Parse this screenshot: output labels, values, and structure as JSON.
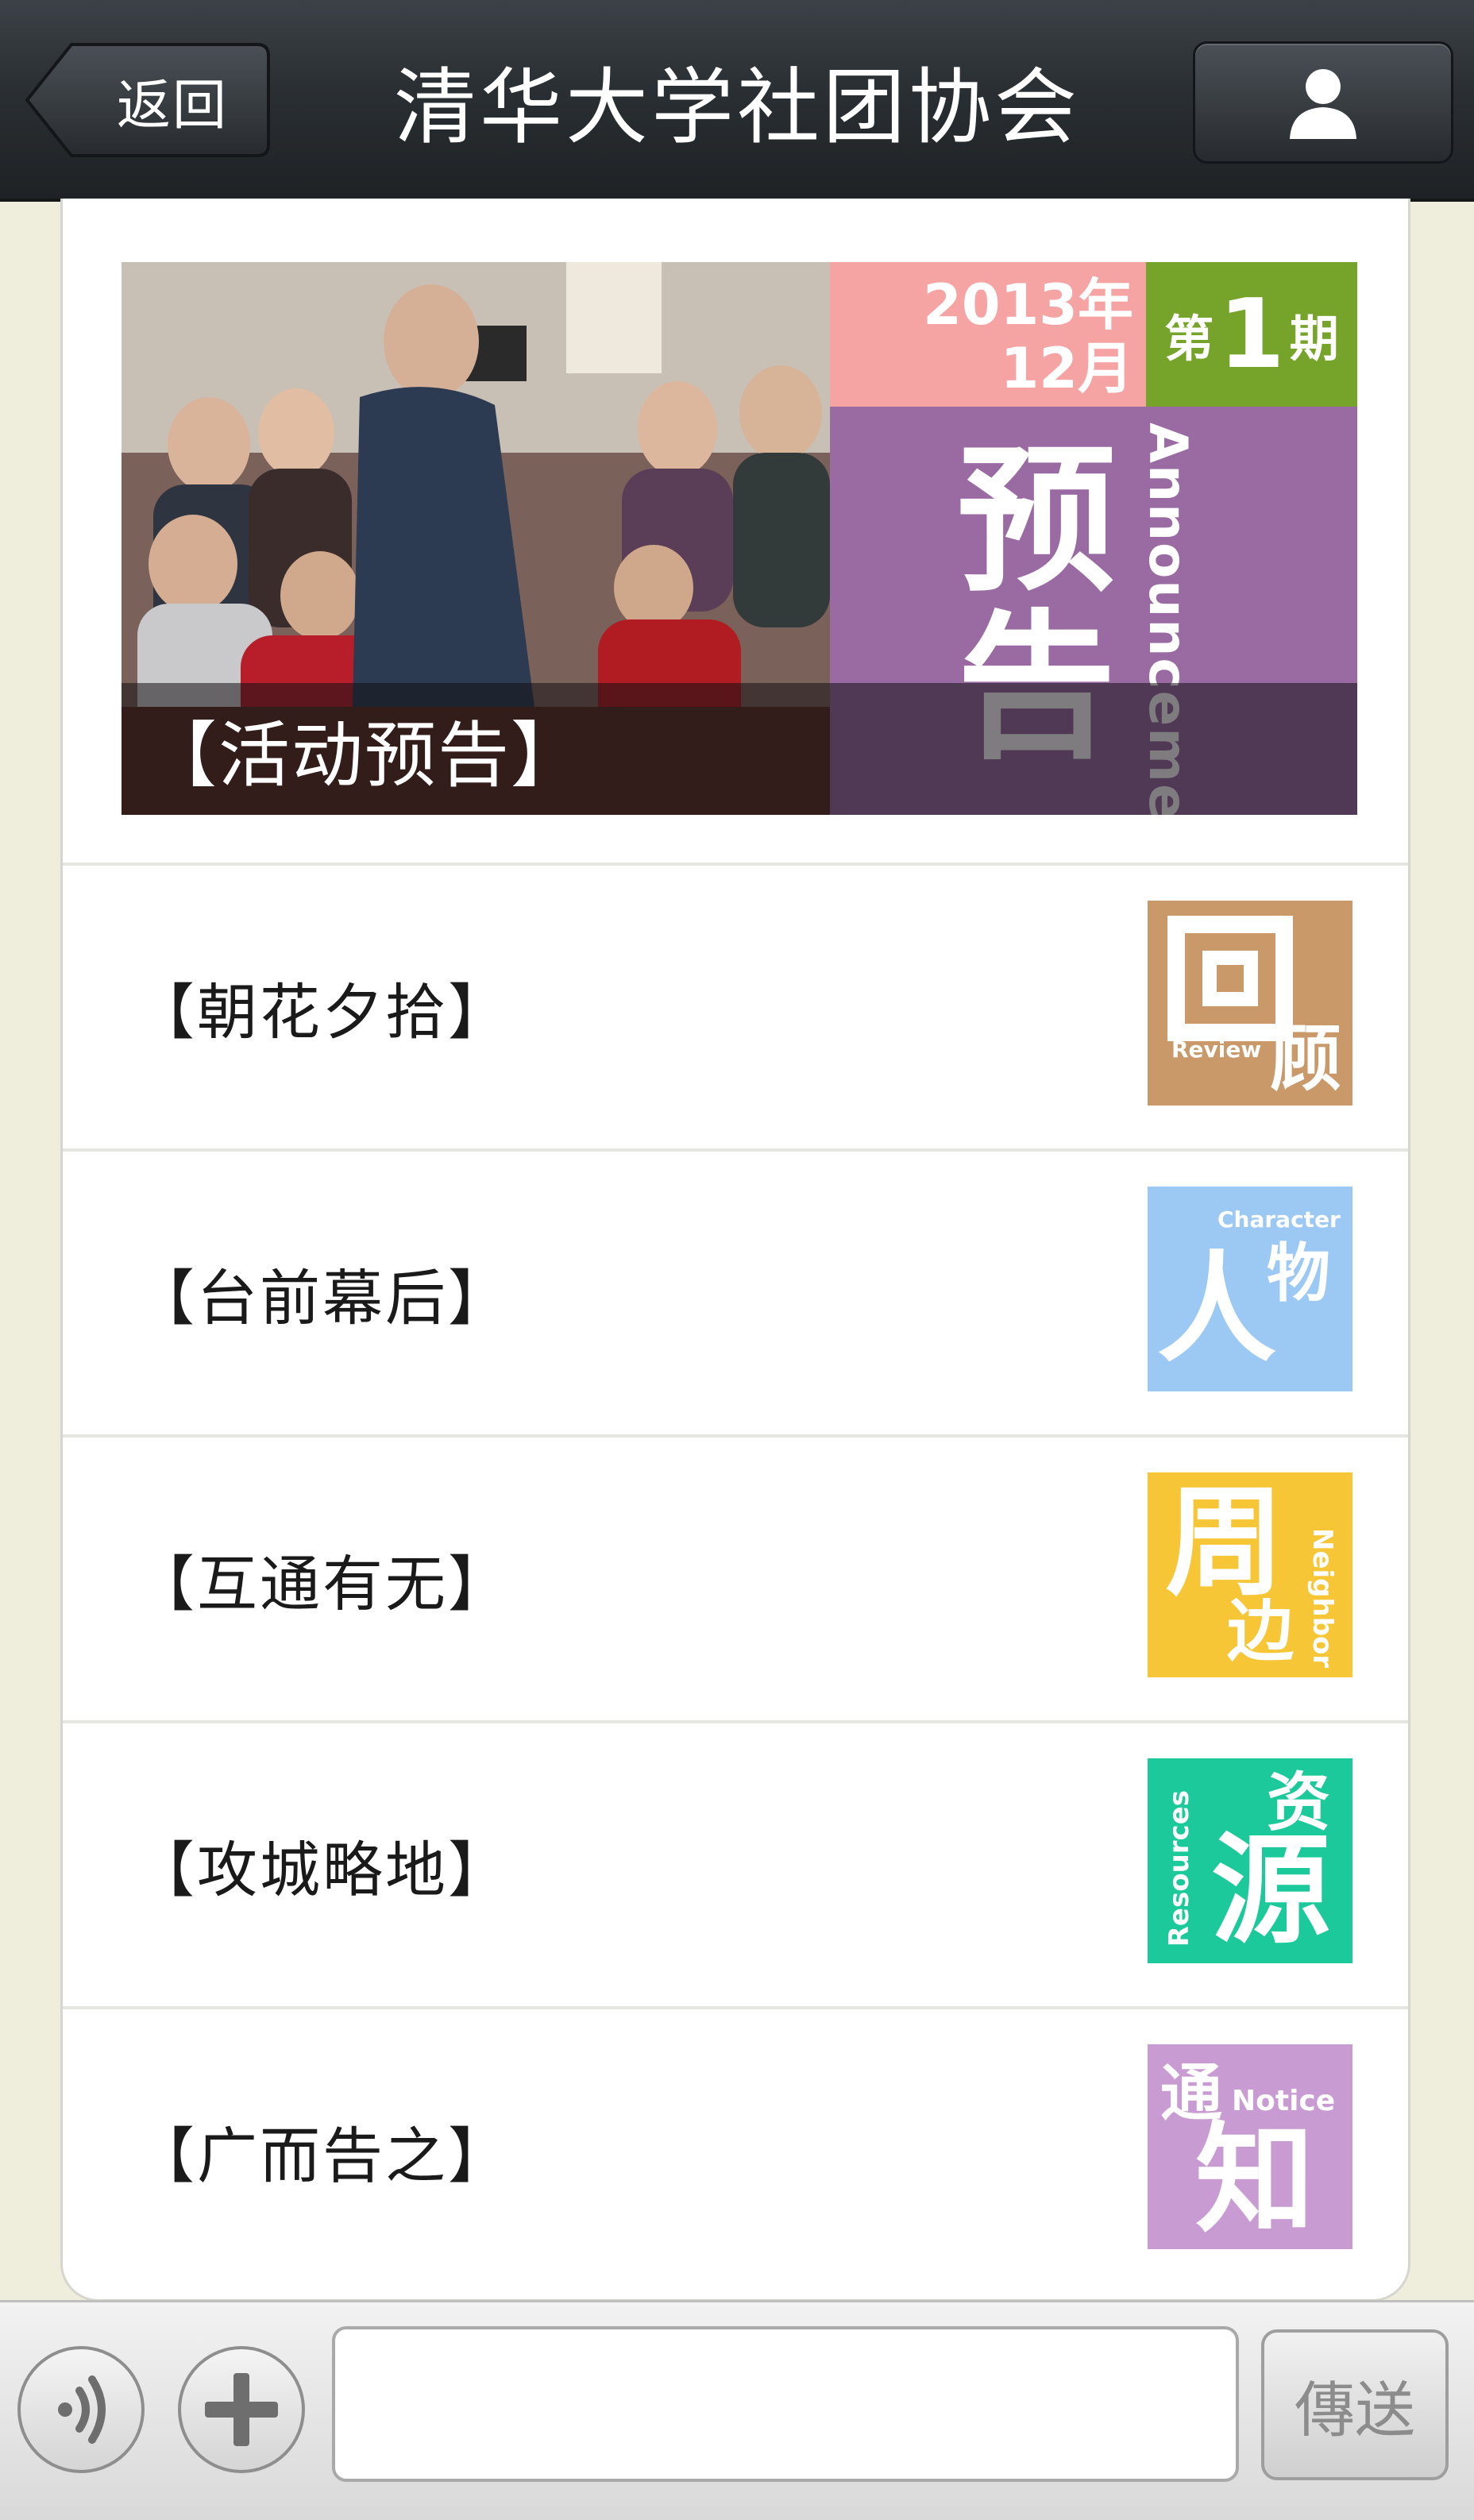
{
  "header": {
    "back_label": "返回",
    "title": "清华大学社团协会",
    "profile_icon": "person-icon"
  },
  "banner": {
    "caption": "【活动预告】",
    "poster": {
      "date_year": "2013年",
      "date_month": "12月",
      "issue_prefix": "第",
      "issue_number": "1",
      "issue_suffix": "期",
      "big_text": "预告",
      "english": "Announcements"
    }
  },
  "items": [
    {
      "label": "【朝花夕拾】",
      "thumb_text": "回顾",
      "thumb_en": "Review",
      "color": "#c9996a"
    },
    {
      "label": "【台前幕后】",
      "thumb_text": "人物",
      "thumb_en": "Character",
      "color": "#9cc9f4"
    },
    {
      "label": "【互通有无】",
      "thumb_text": "周边",
      "thumb_en": "Neighbor",
      "color": "#f6c636"
    },
    {
      "label": "【攻城略地】",
      "thumb_text": "资源",
      "thumb_en": "Resources",
      "color": "#1cc99a"
    },
    {
      "label": "【广而告之】",
      "thumb_text": "通知",
      "thumb_en": "Notice",
      "color": "#c89bd2"
    }
  ],
  "bottom": {
    "voice_icon": "voice-icon",
    "plus_icon": "plus-icon",
    "input_value": "",
    "send_label": "傳送"
  },
  "colors": {
    "header_bg": "#2a2f33",
    "page_bg": "#efeedd",
    "poster_pink": "#f6a3a3",
    "poster_green": "#76a42a",
    "poster_purple": "#9a6aa2"
  }
}
